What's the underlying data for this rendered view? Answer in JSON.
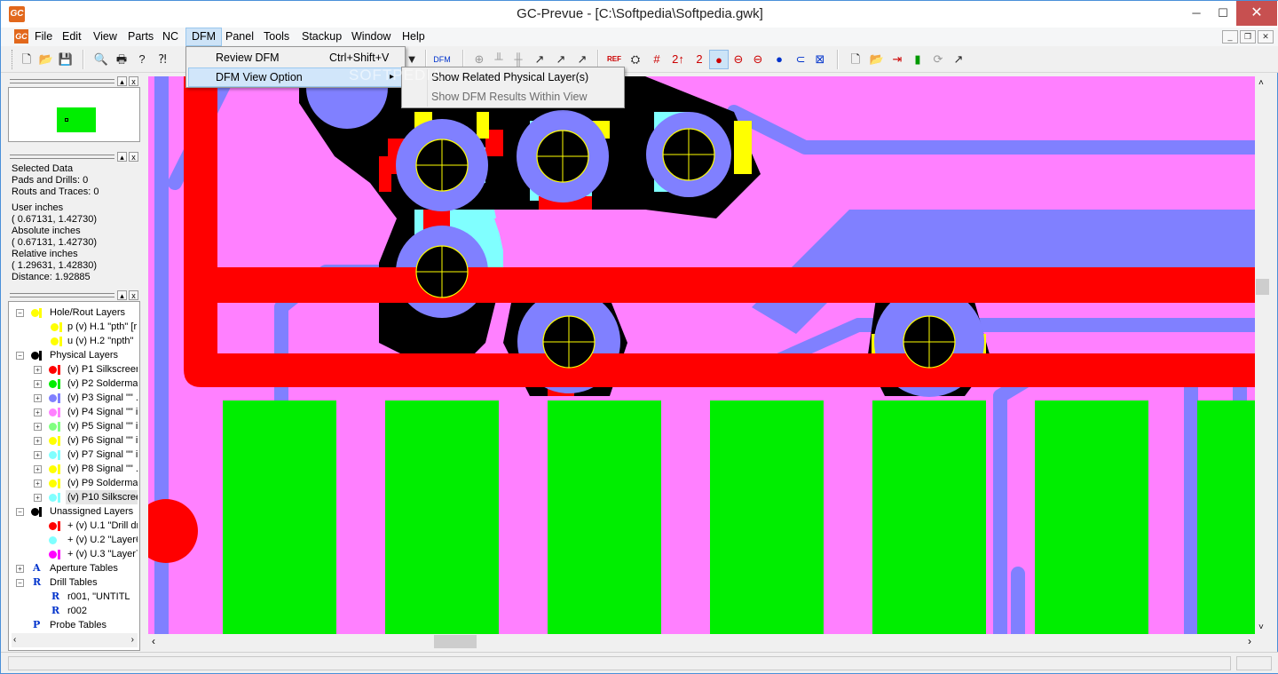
{
  "window": {
    "title": "GC-Prevue - [C:\\Softpedia\\Softpedia.gwk]",
    "icon_text": "GC",
    "min": "─",
    "max": "☐",
    "close": "✕"
  },
  "menubar": {
    "items": [
      "File",
      "Edit",
      "View",
      "Parts",
      "NC",
      "DFM",
      "Panel",
      "Tools",
      "Stackup",
      "Window",
      "Help"
    ]
  },
  "dfm_menu": {
    "review_label": "Review DFM",
    "review_shortcut": "Ctrl+Shift+V",
    "view_option_label": "DFM View Option",
    "submenu_arrow": "▸"
  },
  "dfm_submenu": {
    "item1": "Show Related Physical Layer(s)",
    "item2": "Show DFM Results Within View"
  },
  "info": {
    "selected": "Selected Data",
    "pads": "Pads and Drills: 0",
    "routs": "Routs and Traces: 0",
    "user_label": "User inches",
    "user_val": "( 0.67131,  1.42730)",
    "abs_label": "Absolute inches",
    "abs_val": "( 0.67131,  1.42730)",
    "rel_label": "Relative inches",
    "rel_val": "( 1.29631,  1.42830)",
    "distance": "Distance:  1.92885"
  },
  "tree": {
    "hole_rout": "Hole/Rout Layers",
    "h1": "p (v) H.1 \"pth\" [r",
    "h2": "u (v) H.2 \"npth\"",
    "physical": "Physical Layers",
    "p1": "(v) P1 Silkscreer",
    "p2": "(v) P2 Soldermas",
    "p3": "(v) P3 Signal \"\"  .",
    "p4": "(v) P4 Signal \"\" i",
    "p5": "(v) P5 Signal \"\" i",
    "p6": "(v) P6 Signal \"\" i",
    "p7": "(v) P7 Signal \"\" i",
    "p8": "(v) P8 Signal \"\"  .",
    "p9": "(v) P9 Soldermas",
    "p10": "(v) P10 Silkscree",
    "unassigned": "Unassigned Layers",
    "u1": "+ (v) U.1 \"Drill dr",
    "u2": "+ (v) U.2 \"Layer6",
    "u3": "+ (v) U.3 \"Layer7",
    "aperture": "Aperture Tables",
    "drill": "Drill Tables",
    "r001": "r001, \"UNTITL",
    "r002": "r002",
    "probe": "Probe Tables"
  },
  "watermark": "SOFTPEDIA",
  "colors": {
    "canvas": "#ff80ff",
    "pad_ring": "#8080ff",
    "trace_red": "#ff0000",
    "pad_green": "#00ee00",
    "black": "#000000",
    "cyan": "#80ffff",
    "yellow": "#ffff00"
  }
}
